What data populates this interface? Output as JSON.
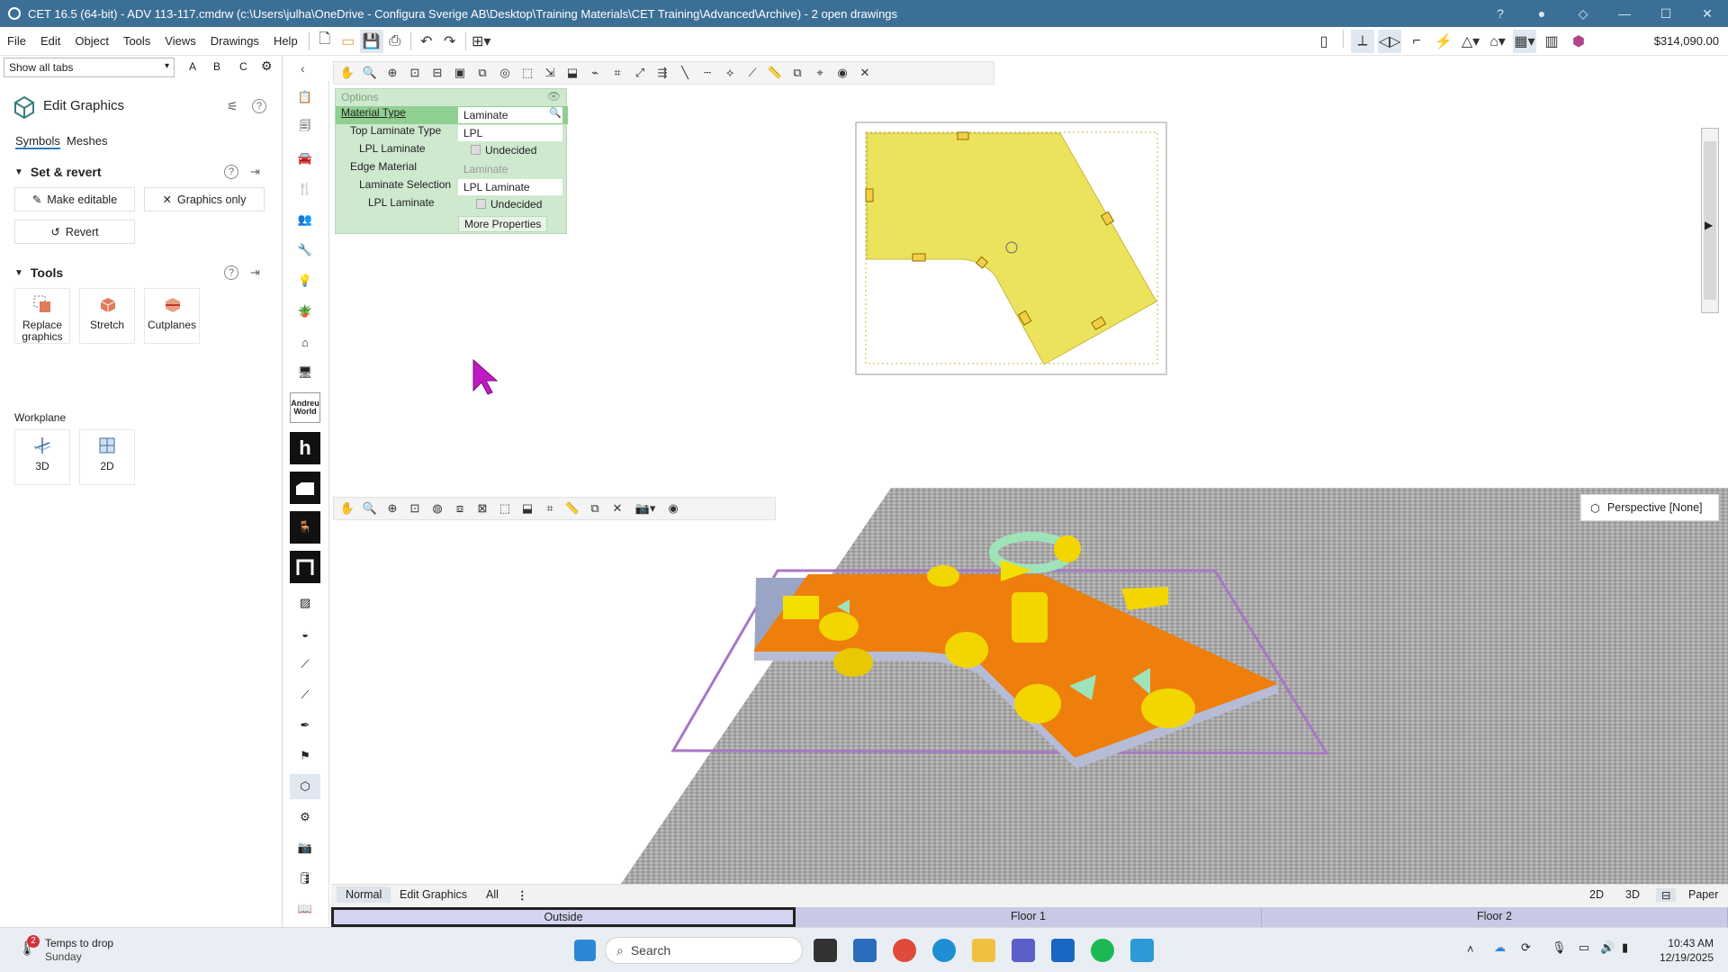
{
  "window": {
    "title": "CET 16.5 (64-bit) - ADV 113-117.cmdrw (c:\\Users\\julha\\OneDrive - Configura Sverige AB\\Desktop\\Training Materials\\CET Training\\Advanced\\Archive) - 2  open drawings",
    "price": "$314,090.00"
  },
  "menu": [
    "File",
    "Edit",
    "Object",
    "Tools",
    "Views",
    "Drawings",
    "Help"
  ],
  "left_panel": {
    "tab_select": "Show all tabs",
    "abc": [
      "A",
      "B",
      "C"
    ],
    "title": "Edit Graphics",
    "subtabs": [
      "Symbols",
      "Meshes"
    ],
    "set_revert": {
      "heading": "Set & revert",
      "make_editable": "Make editable",
      "graphics_only": "Graphics only",
      "revert": "Revert"
    },
    "tools": {
      "heading": "Tools",
      "items": [
        "Replace graphics",
        "Stretch",
        "Cutplanes"
      ]
    },
    "workplane": {
      "label": "Workplane",
      "items": [
        "3D",
        "2D"
      ]
    }
  },
  "options": {
    "header": "Options",
    "rows": [
      {
        "label": "Material Type",
        "value": "Laminate"
      },
      {
        "label": "Top Laminate Type",
        "value": "LPL"
      },
      {
        "label": "LPL Laminate",
        "value": "Undecided"
      },
      {
        "label": "Edge Material",
        "value": "Laminate"
      },
      {
        "label": "Laminate Selection",
        "value": "LPL Laminate"
      },
      {
        "label": "LPL Laminate",
        "value": "Undecided"
      }
    ],
    "more": "More Properties"
  },
  "strip_labels": {
    "andreu": "Andreu World",
    "h": "h"
  },
  "view3d": {
    "perspective": "Perspective [None]"
  },
  "bottom_tabs": [
    "Normal",
    "Edit Graphics",
    "All"
  ],
  "view_modes": [
    "2D",
    "3D",
    "Paper"
  ],
  "floors": [
    "Outside",
    "Floor 1",
    "Floor 2"
  ],
  "taskbar": {
    "weather_title": "Temps to drop",
    "weather_day": "Sunday",
    "weather_badge": "2",
    "search": "Search",
    "time": "10:43 AM",
    "date": "12/19/2025"
  }
}
